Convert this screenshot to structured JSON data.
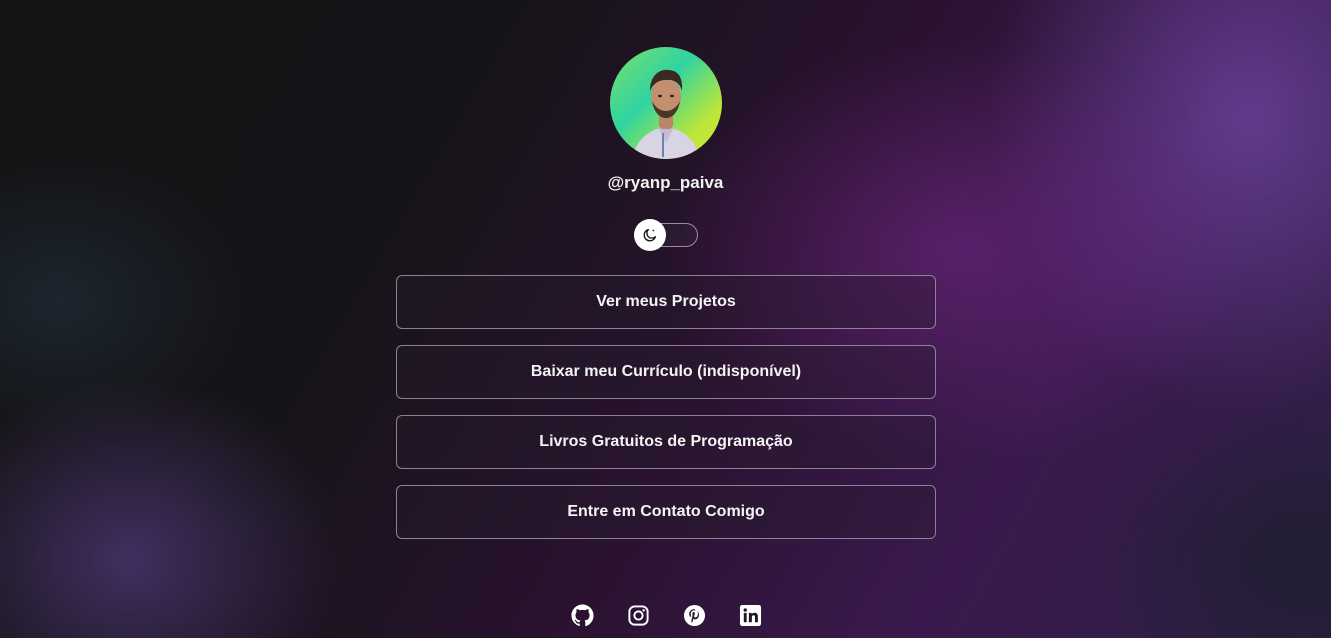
{
  "profile": {
    "handle": "@ryanp_paiva",
    "avatar_alt": "profile-photo"
  },
  "theme_toggle": {
    "icon": "moon-icon",
    "state": "dark"
  },
  "links": [
    {
      "label": "Ver meus Projetos"
    },
    {
      "label": "Baixar meu Currículo (indisponível)"
    },
    {
      "label": "Livros Gratuitos de Programação"
    },
    {
      "label": "Entre em Contato Comigo"
    }
  ],
  "socials": [
    {
      "icon": "github-icon"
    },
    {
      "icon": "instagram-icon"
    },
    {
      "icon": "pinterest-icon"
    },
    {
      "icon": "linkedin-icon"
    }
  ],
  "colors": {
    "accent_purple": "#5c2466",
    "button_border": "#8c8296",
    "text": "#ffffff"
  }
}
